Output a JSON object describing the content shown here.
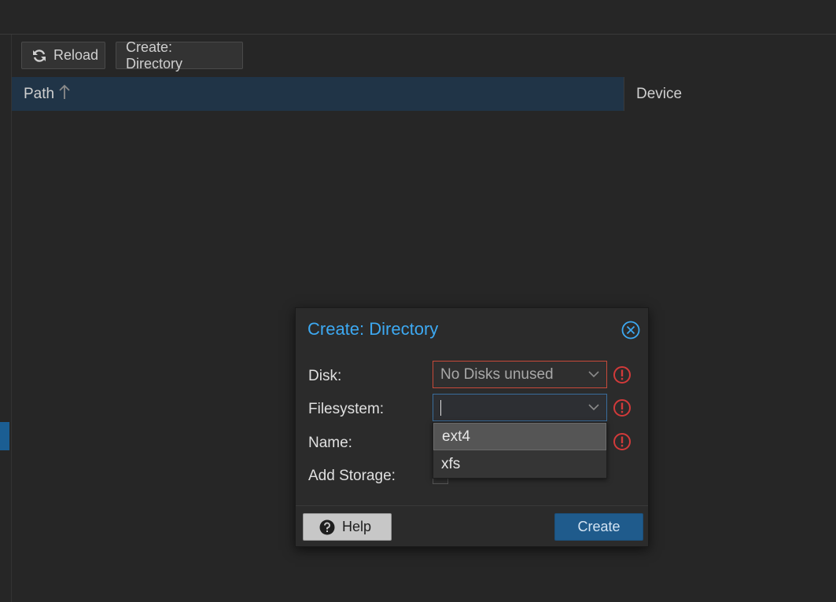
{
  "toolbar": {
    "reload_label": "Reload",
    "create_directory_label": "Create: Directory"
  },
  "grid": {
    "columns": [
      {
        "label": "Path",
        "sort": "ascending"
      },
      {
        "label": "Device"
      }
    ]
  },
  "dialog": {
    "title": "Create: Directory",
    "fields": {
      "disk": {
        "label": "Disk:",
        "value": "No Disks unused",
        "invalid": true
      },
      "filesystem": {
        "label": "Filesystem:",
        "value": "",
        "invalid": true
      },
      "name": {
        "label": "Name:",
        "invalid": true
      },
      "add_storage": {
        "label": "Add Storage:",
        "checked": true
      }
    },
    "filesystem_options": [
      "ext4",
      "xfs"
    ],
    "help_label": "Help",
    "create_label": "Create"
  },
  "colors": {
    "accent_title": "#3da9f2",
    "primary_button": "#1f5b8c",
    "error": "#d23a3a",
    "header_selected": "#203447"
  },
  "icons": {
    "reload": "refresh-icon",
    "sort": "arrow-up-icon",
    "close": "close-circle-icon",
    "error": "exclamation-circle-icon",
    "help": "question-circle-icon",
    "dropdown": "chevron-down-icon"
  }
}
